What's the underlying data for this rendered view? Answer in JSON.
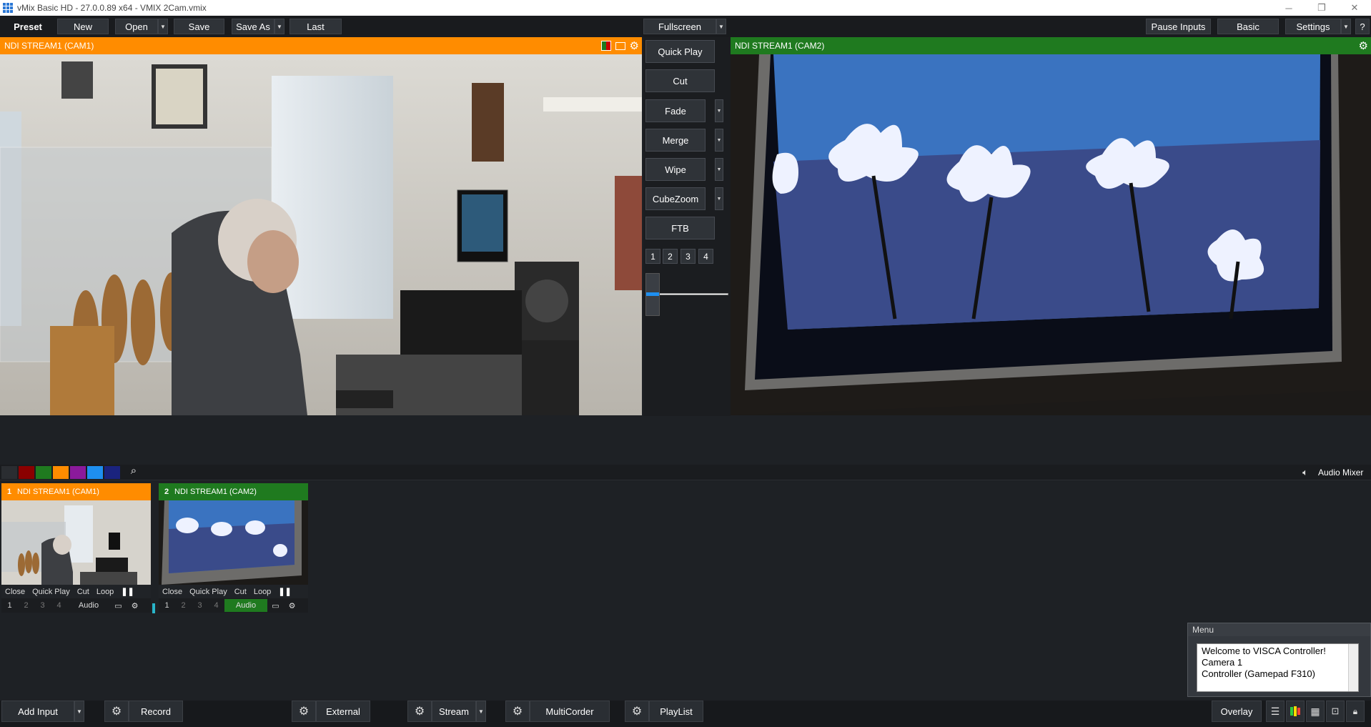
{
  "window": {
    "title": "vMix Basic HD - 27.0.0.89 x64 - VMIX 2Cam.vmix",
    "minimize": "─",
    "maximize": "❐",
    "close": "✕"
  },
  "toolbar": {
    "preset": "Preset",
    "new": "New",
    "open": "Open",
    "save": "Save",
    "save_as": "Save As",
    "last": "Last",
    "fullscreen": "Fullscreen",
    "pause_inputs": "Pause Inputs",
    "basic": "Basic",
    "settings": "Settings",
    "help": "?"
  },
  "preview": {
    "title": "NDI STREAM1 (CAM1)"
  },
  "output": {
    "title": "NDI STREAM1 (CAM2)"
  },
  "transitions": {
    "quick_play": "Quick Play",
    "cut": "Cut",
    "fade": "Fade",
    "merge": "Merge",
    "wipe": "Wipe",
    "cubezoom": "CubeZoom",
    "ftb": "FTB",
    "numbers": [
      "1",
      "2",
      "3",
      "4"
    ],
    "tbar_position": 0.0
  },
  "filter": {
    "colors": [
      "#2a2d31",
      "#8b0000",
      "#1f7a1f",
      "#ff8c00",
      "#8b1a9b",
      "#1e8ff0",
      "#1a237e"
    ],
    "audio_mixer": "Audio Mixer"
  },
  "inputs": [
    {
      "number": "1",
      "name": "NDI STREAM1 (CAM1)",
      "color": "#ff8c00",
      "controls": [
        "Close",
        "Quick Play",
        "Cut",
        "Loop"
      ],
      "overlays": [
        "1",
        "2",
        "3",
        "4"
      ],
      "audio": "Audio"
    },
    {
      "number": "2",
      "name": "NDI STREAM1 (CAM2)",
      "color": "#1f7a1f",
      "controls": [
        "Close",
        "Quick Play",
        "Cut",
        "Loop"
      ],
      "overlays": [
        "1",
        "2",
        "3",
        "4"
      ],
      "audio": "Audio"
    }
  ],
  "menu": {
    "title": "Menu",
    "lines": [
      "Welcome to VISCA Controller!",
      "Camera 1",
      "Controller (Gamepad F310)"
    ]
  },
  "bottom": {
    "add_input": "Add Input",
    "record": "Record",
    "external": "External",
    "stream": "Stream",
    "multicorder": "MultiCorder",
    "playlist": "PlayList",
    "overlay": "Overlay"
  },
  "colors": {
    "preview_accent": "#ff8c00",
    "output_accent": "#1f7a1f",
    "audio_active": "#1f7a1f"
  }
}
